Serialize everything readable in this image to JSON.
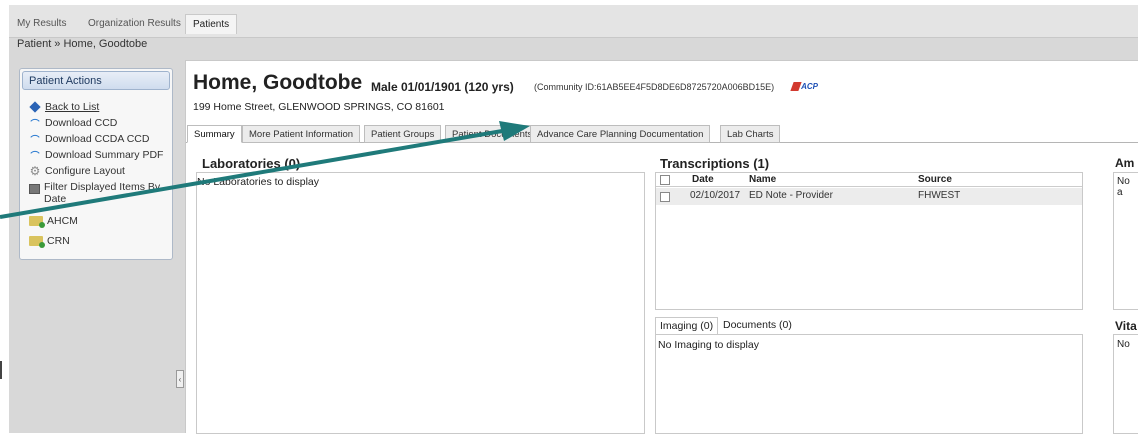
{
  "top_tabs": [
    "My Results",
    "Organization Results",
    "Patients"
  ],
  "breadcrumb": "Patient » Home, Goodtobe",
  "patient_actions": {
    "title": "Patient Actions",
    "items": [
      {
        "label": "Back to List",
        "icon": "back-arrow-icon"
      },
      {
        "label": "Download CCD",
        "icon": "download-icon"
      },
      {
        "label": "Download CCDA CCD",
        "icon": "download-icon"
      },
      {
        "label": "Download Summary PDF",
        "icon": "download-icon"
      },
      {
        "label": "Configure Layout",
        "icon": "gear-icon"
      },
      {
        "label": "Filter Displayed Items By Date",
        "icon": "filter-icon"
      },
      {
        "label": "AHCM",
        "icon": "folder-icon"
      },
      {
        "label": "CRN",
        "icon": "folder-icon"
      }
    ]
  },
  "patient": {
    "name": "Home, Goodtobe",
    "demographics": "Male  01/01/1901 (120 yrs)",
    "community_id": "(Community ID:61AB5EE4F5D8DE6D8725720A006BD15E)",
    "logo_text": "ACP",
    "address": "199 Home Street, GLENWOOD SPRINGS, CO 81601"
  },
  "content_tabs": [
    "Summary",
    "More Patient Information",
    "Patient Groups",
    "Patient Documents",
    "Advance Care Planning Documentation",
    "Lab Charts"
  ],
  "laboratories": {
    "title": "Laboratories (0)",
    "empty": "No Laboratories to display"
  },
  "transcriptions": {
    "title": "Transcriptions (1)",
    "columns": [
      "Date",
      "Name",
      "Source"
    ],
    "rows": [
      {
        "date": "02/10/2017",
        "name": "ED Note - Provider",
        "source": "FHWEST"
      }
    ]
  },
  "imaging": {
    "tabs": [
      "Imaging (0)",
      "Documents (0)"
    ],
    "empty": "No Imaging to display"
  },
  "right_column": {
    "top_title": "Am",
    "top_text": "No a",
    "bottom_title": "Vita",
    "bottom_text": "No"
  },
  "colors": {
    "accent": "#1f7a7a",
    "header_blue": "#cfdcee"
  }
}
